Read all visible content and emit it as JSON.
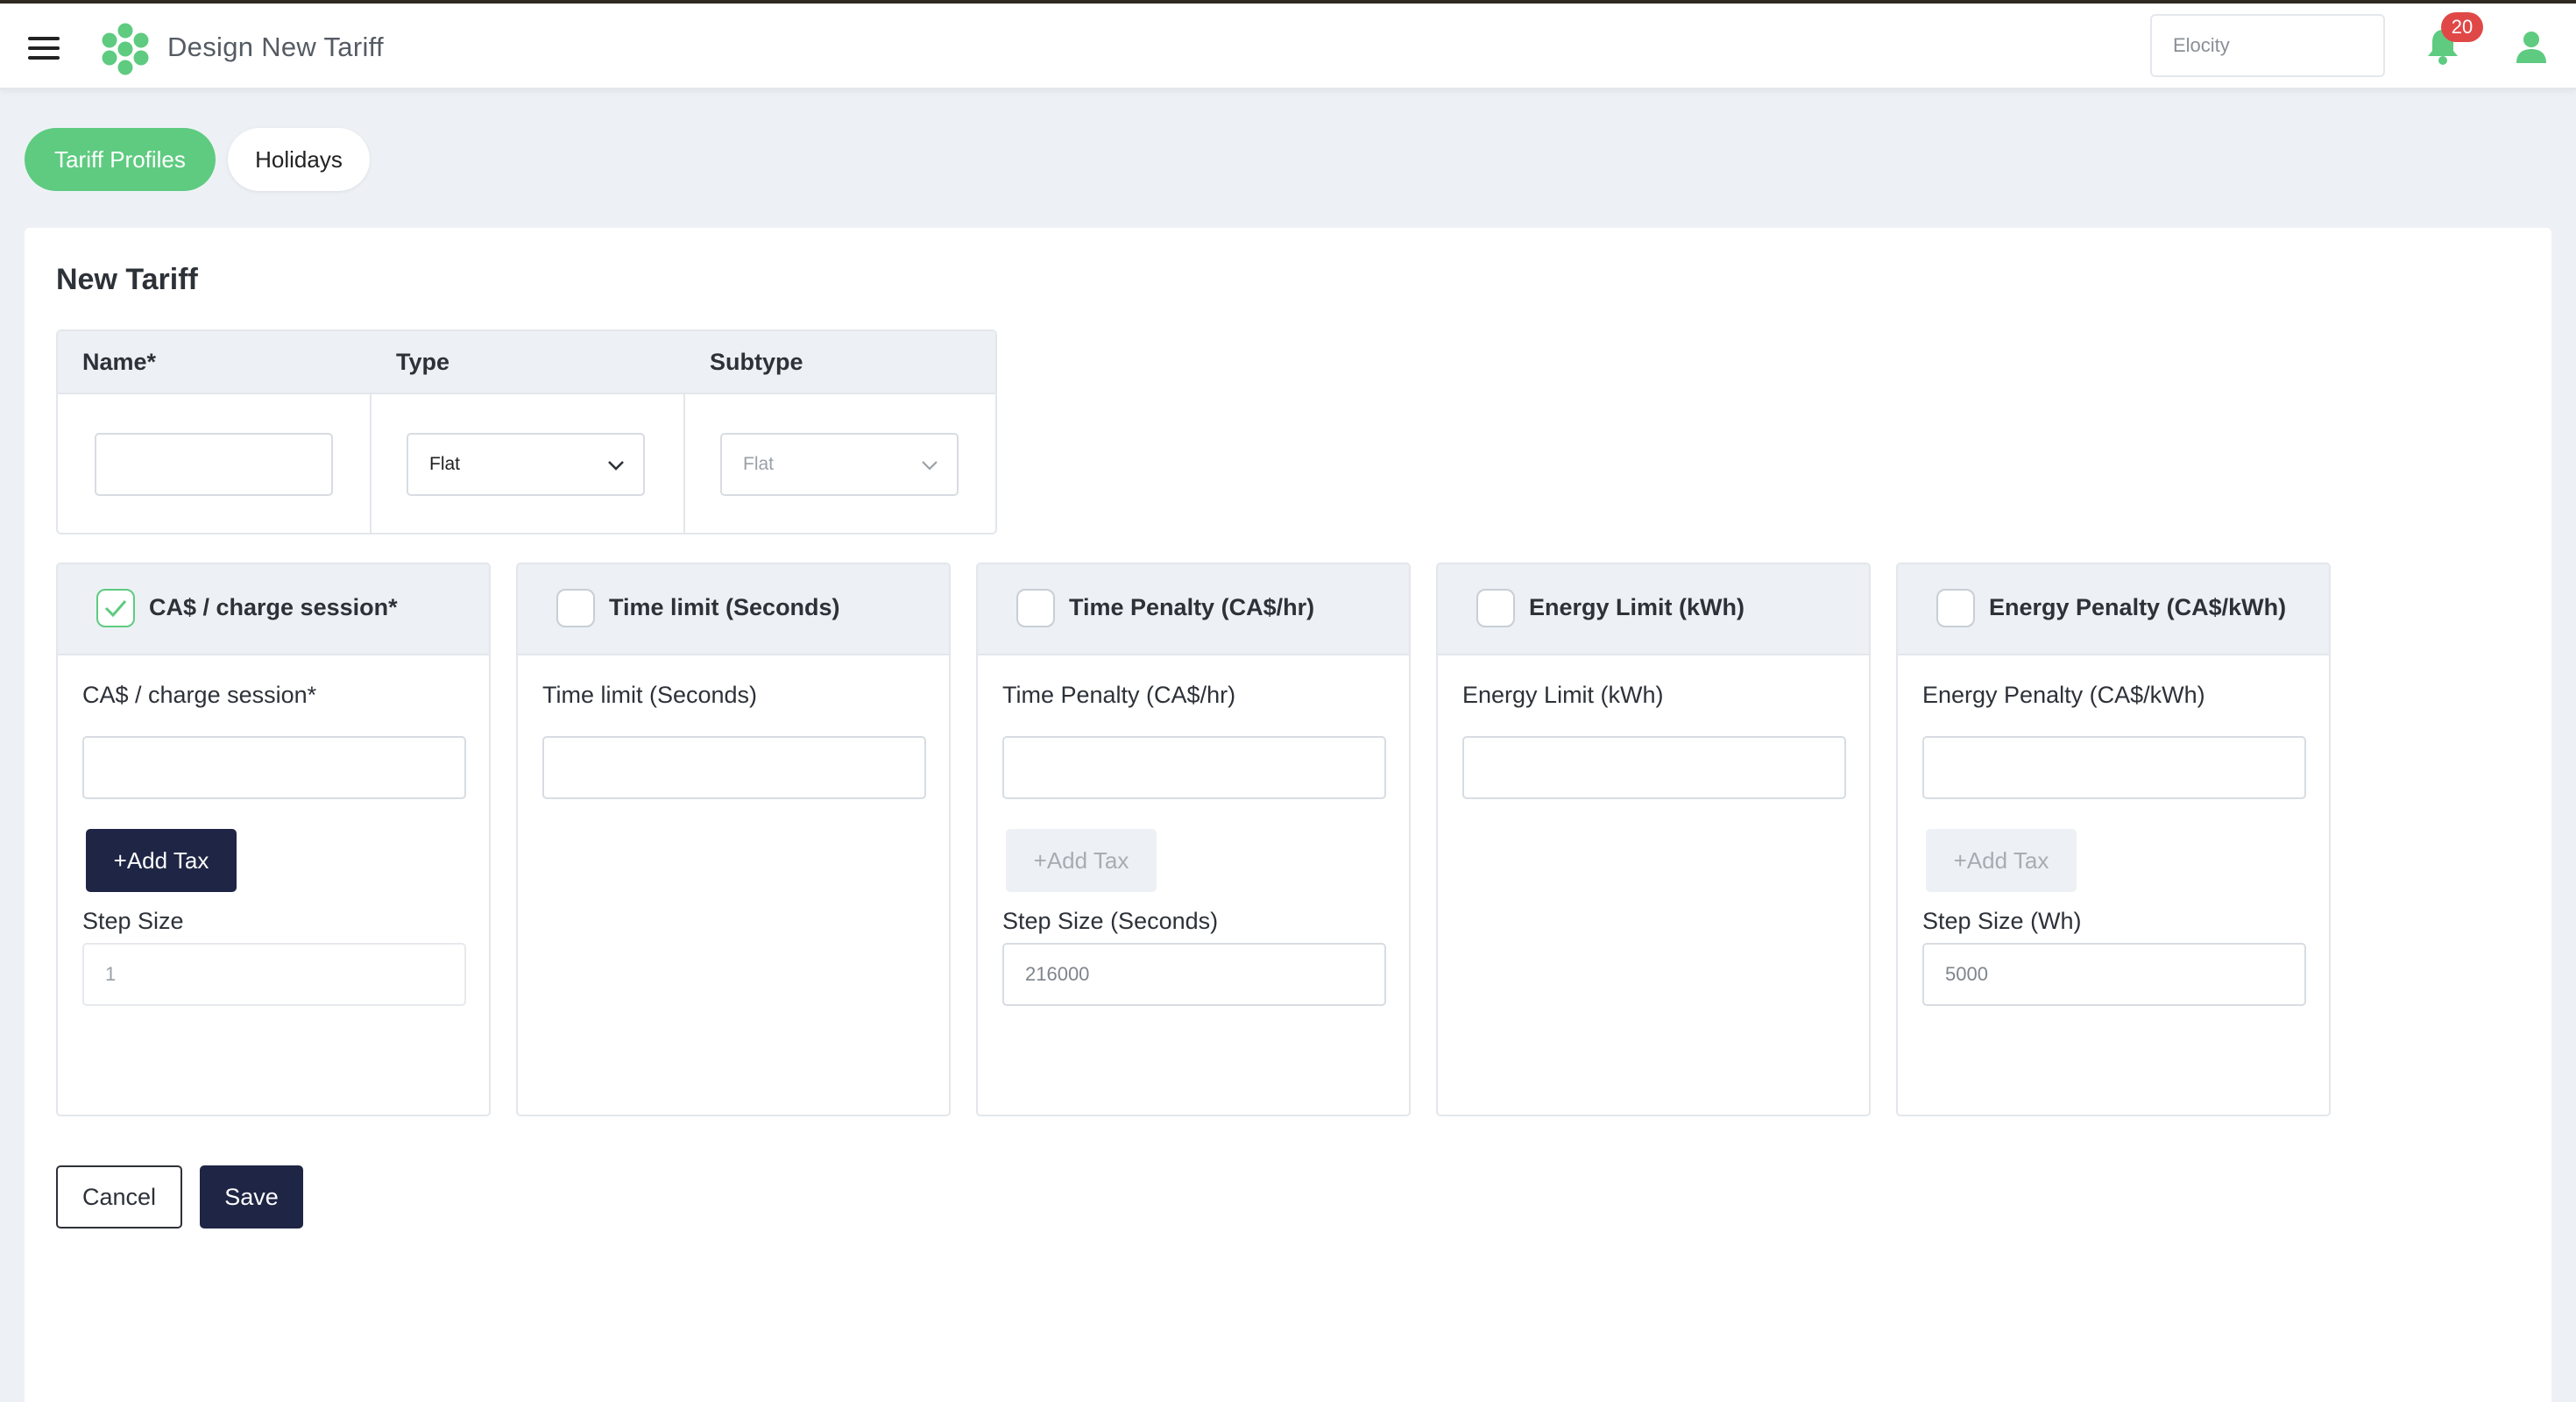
{
  "header": {
    "title": "Design New Tariff",
    "org_placeholder": "Elocity",
    "notification_count": "20",
    "brand_color": "#5ecb80"
  },
  "tabs": [
    {
      "label": "Tariff Profiles",
      "active": true
    },
    {
      "label": "Holidays",
      "active": false
    }
  ],
  "form": {
    "title": "New Tariff",
    "name_label": "Name*",
    "type_label": "Type",
    "subtype_label": "Subtype",
    "type_value": "Flat",
    "subtype_value": "Flat"
  },
  "columns": [
    {
      "title": "CA$ / charge session*",
      "checked": true,
      "field_label": "CA$ / charge session*",
      "add_tax": "+Add Tax",
      "step_label": "Step Size",
      "step_value": "1"
    },
    {
      "title": "Time limit (Seconds)",
      "checked": false,
      "field_label": "Time limit (Seconds)"
    },
    {
      "title": "Time Penalty (CA$/hr)",
      "checked": false,
      "field_label": "Time Penalty (CA$/hr)",
      "add_tax": "+Add Tax",
      "step_label": "Step Size (Seconds)",
      "step_value": "216000"
    },
    {
      "title": "Energy Limit (kWh)",
      "checked": false,
      "field_label": "Energy Limit (kWh)"
    },
    {
      "title": "Energy Penalty (CA$/kWh)",
      "checked": false,
      "field_label": "Energy Penalty (CA$/kWh)",
      "add_tax": "+Add Tax",
      "step_label": "Step Size (Wh)",
      "step_value": "5000"
    }
  ],
  "actions": {
    "cancel": "Cancel",
    "save": "Save"
  }
}
